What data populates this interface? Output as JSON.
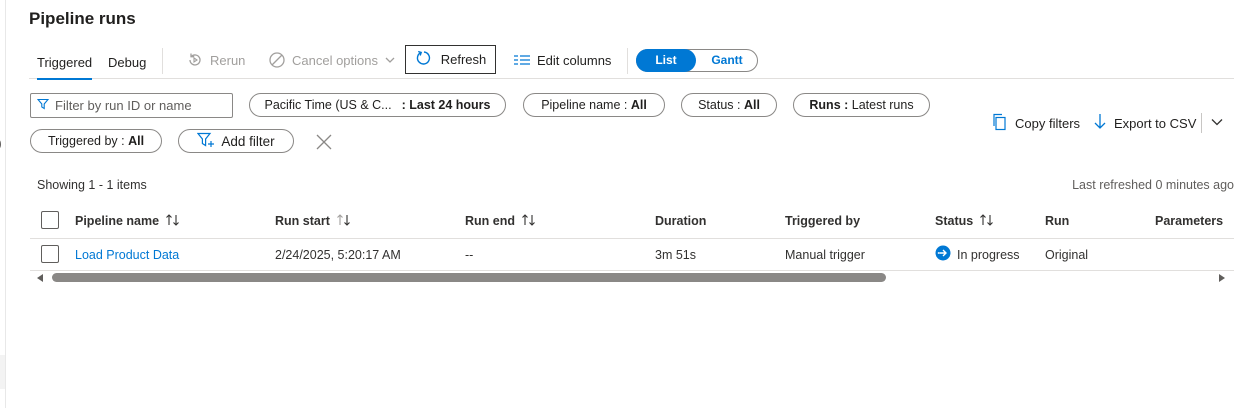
{
  "page": {
    "title": "Pipeline runs"
  },
  "toolbar": {
    "tabs": [
      {
        "label": "Triggered",
        "active": true
      },
      {
        "label": "Debug",
        "active": false
      }
    ],
    "rerun_label": "Rerun",
    "cancel_label": "Cancel options",
    "refresh_label": "Refresh",
    "edit_columns_label": "Edit columns",
    "view_toggle": {
      "list": "List",
      "gantt": "Gantt",
      "selected": "List"
    }
  },
  "filters": {
    "search_placeholder": "Filter by run ID or name",
    "time": {
      "label": "Pacific Time (US & C...",
      "value": ": Last 24 hours"
    },
    "pipeline_name": {
      "label": "Pipeline name : ",
      "value": "All"
    },
    "status": {
      "label": "Status : ",
      "value": "All"
    },
    "runs": {
      "label": "Runs : ",
      "value": "Latest runs"
    },
    "triggered_by": {
      "label": "Triggered by : ",
      "value": "All"
    },
    "add_filter_label": "Add filter"
  },
  "actions": {
    "copy_filters": "Copy filters",
    "export_csv": "Export to CSV"
  },
  "summary": {
    "showing": "Showing 1 - 1 items",
    "last_refreshed": "Last refreshed 0 minutes ago"
  },
  "table": {
    "columns": [
      "Pipeline name",
      "Run start",
      "Run end",
      "Duration",
      "Triggered by",
      "Status",
      "Run",
      "Parameters"
    ],
    "rows": [
      {
        "pipeline_name": "Load Product Data",
        "run_start": "2/24/2025, 5:20:17 AM",
        "run_end": "--",
        "duration": "3m 51s",
        "triggered_by": "Manual trigger",
        "status": "In progress",
        "run": "Original",
        "parameters": ""
      }
    ]
  },
  "colors": {
    "accent": "#0078d4",
    "text": "#323130",
    "disabled": "#a19f9d",
    "border": "#8a8886"
  }
}
